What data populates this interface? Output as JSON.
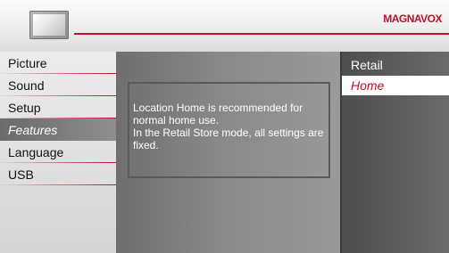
{
  "header": {
    "brand": "MAGNAVOX",
    "accent_color": "#b8142a",
    "icon": "tv-icon"
  },
  "menu": {
    "items": [
      {
        "label": "Picture",
        "selected": false
      },
      {
        "label": "Sound",
        "selected": false
      },
      {
        "label": "Setup",
        "selected": false
      },
      {
        "label": "Features",
        "selected": true
      },
      {
        "label": "Language",
        "selected": false
      },
      {
        "label": "USB",
        "selected": false
      }
    ]
  },
  "info": {
    "line1": "Location Home is recommended for normal home use.",
    "line2": "In the Retail Store mode, all settings are fixed."
  },
  "options": {
    "items": [
      {
        "label": "Retail",
        "selected": false
      },
      {
        "label": "Home",
        "selected": true
      }
    ]
  }
}
